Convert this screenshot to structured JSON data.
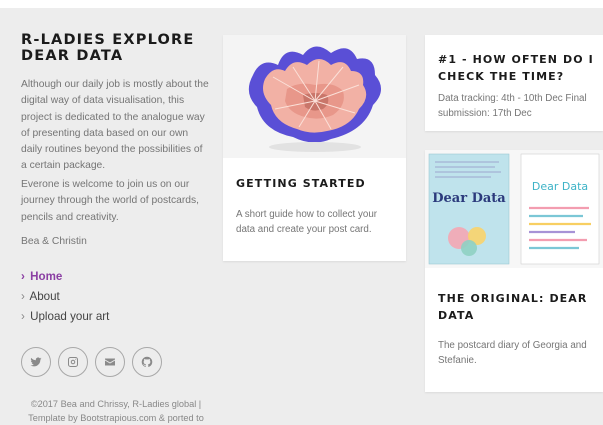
{
  "sidebar": {
    "title": "R-LADIES EXPLORE DEAR DATA",
    "intro": "Although our daily job is mostly about the digital way of data visualisation, this project is dedicated to the analogue way of presenting data based on our own daily routines beyond the possibilities of a certain package.",
    "welcome": "Everone is welcome to join us on our journey through the world of postcards, pencils and creativity.",
    "signature": "Bea & Christin",
    "nav": [
      {
        "label": "Home",
        "active": true
      },
      {
        "label": "About",
        "active": false
      },
      {
        "label": "Upload your art",
        "active": false
      }
    ],
    "socials": [
      "twitter-icon",
      "instagram-icon",
      "email-icon",
      "github-icon"
    ],
    "footer": "©2017 Bea and Chrissy, R-Ladies global | Template by Bootstrapious.com & ported to"
  },
  "cards": {
    "getting_started": {
      "title": "GETTING STARTED",
      "text": "A short guide how to collect your data and create your post card.",
      "image_icon": "pencil-shaving-image"
    },
    "check_time": {
      "title": "#1 - HOW OFTEN DO I CHECK THE TIME?",
      "text": "Data tracking: 4th - 10th Dec Final submission: 17th Dec"
    },
    "dear_data": {
      "title": "THE ORIGINAL: DEAR DATA",
      "text": "The postcard diary of Georgia and Stefanie.",
      "image_icon": "dear-data-books-image",
      "book_title": "Dear Data"
    }
  },
  "colors": {
    "accent": "#8b3fa3",
    "background": "#ededed"
  }
}
